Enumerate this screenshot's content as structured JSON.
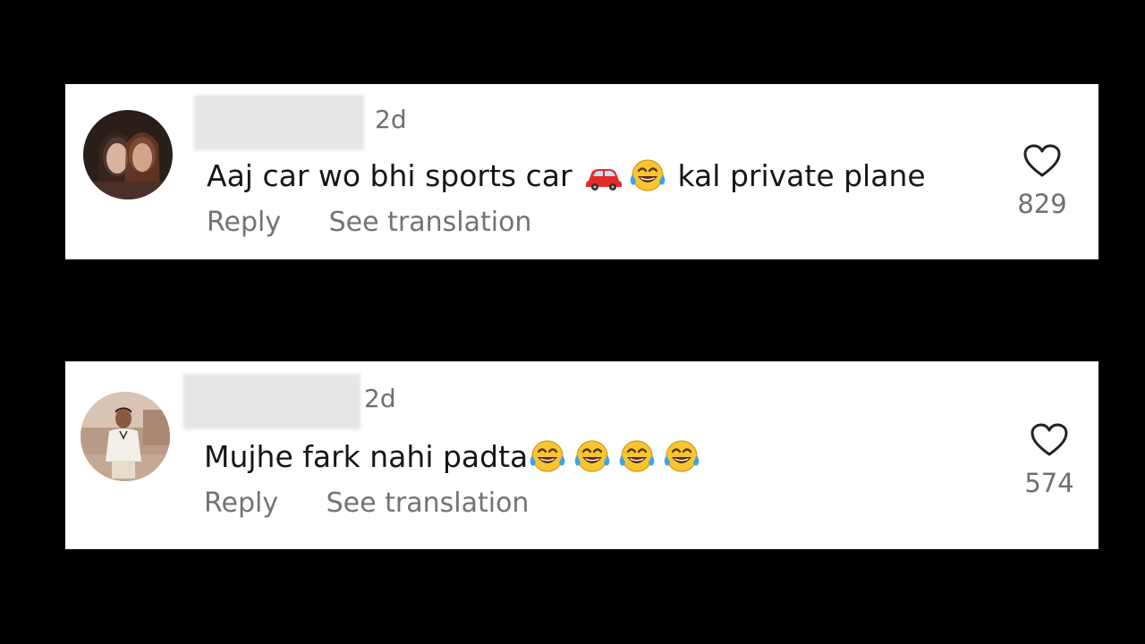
{
  "comments": [
    {
      "time": "2d",
      "text_before": "Aaj car wo bhi sports car",
      "text_after": "kal private plane",
      "emojis": [
        "red-car-icon",
        "tears-of-joy-icon"
      ],
      "actions": {
        "reply": "Reply",
        "translate": "See translation"
      },
      "likes": "829"
    },
    {
      "time": "2d",
      "text_before": "Mujhe fark nahi padta",
      "emojis": [
        "tears-of-joy-icon",
        "tears-of-joy-icon",
        "tears-of-joy-icon",
        "tears-of-joy-icon"
      ],
      "actions": {
        "reply": "Reply",
        "translate": "See translation"
      },
      "likes": "574"
    }
  ],
  "colors": {
    "background": "#000000",
    "card": "#ffffff",
    "text": "#161616",
    "secondary_text": "#737373",
    "emoji_yellow": "#f7c531",
    "car_red": "#e52a2a"
  }
}
